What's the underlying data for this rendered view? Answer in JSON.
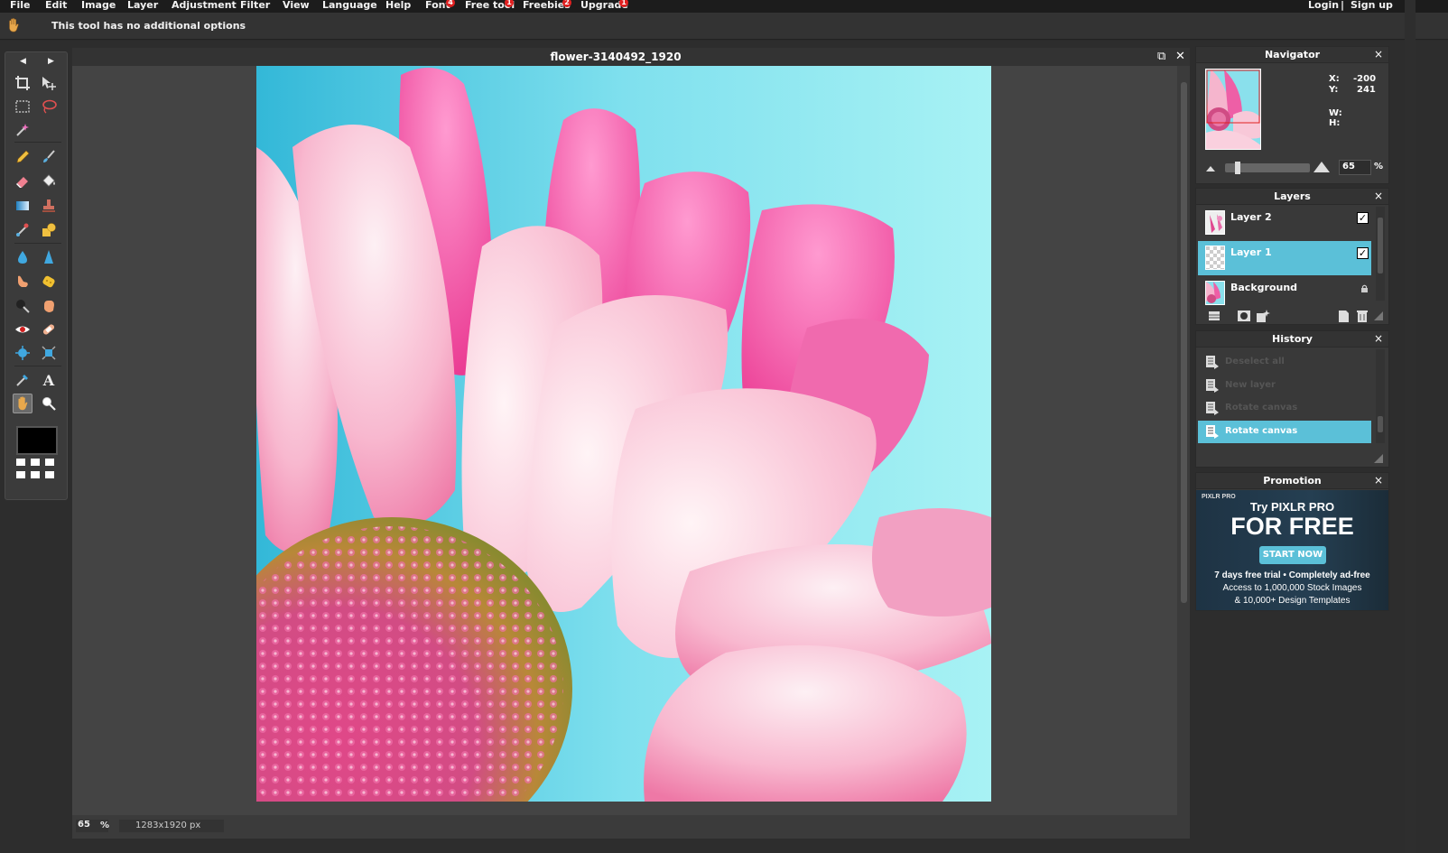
{
  "menubar": {
    "items": [
      {
        "label": "File"
      },
      {
        "label": "Edit"
      },
      {
        "label": "Image"
      },
      {
        "label": "Layer"
      },
      {
        "label": "Adjustment"
      },
      {
        "label": "Filter"
      },
      {
        "label": "View"
      },
      {
        "label": "Language"
      },
      {
        "label": "Help"
      },
      {
        "label": "Font",
        "badge": "4"
      },
      {
        "label": "Free tool",
        "badge": "1"
      },
      {
        "label": "Freebies",
        "badge": "2"
      },
      {
        "label": "Upgrade",
        "badge": "1"
      }
    ],
    "login": "Login",
    "separator": "|",
    "signup": "Sign up"
  },
  "optionsbar": {
    "tool_icon": "hand-icon",
    "text": "This tool has no additional options"
  },
  "document": {
    "title": "flower-3140492_1920",
    "zoom": "65",
    "zoom_unit": "%",
    "dimensions": "1283x1920 px"
  },
  "navigator": {
    "title": "Navigator",
    "close": "×",
    "x_label": "X:",
    "x_value": "-200",
    "y_label": "Y:",
    "y_value": "241",
    "w_label": "W:",
    "h_label": "H:",
    "zoom": "65",
    "zoom_unit": "%"
  },
  "layers": {
    "title": "Layers",
    "close": "×",
    "items": [
      {
        "name": "Layer 2",
        "visible": true,
        "selected": false
      },
      {
        "name": "Layer 1",
        "visible": true,
        "selected": true
      },
      {
        "name": "Background",
        "locked": true,
        "selected": false
      }
    ]
  },
  "history": {
    "title": "History",
    "close": "×",
    "items": [
      {
        "label": "Deselect all"
      },
      {
        "label": "New layer"
      },
      {
        "label": "Rotate canvas"
      },
      {
        "label": "Rotate canvas",
        "selected": true
      }
    ]
  },
  "promotion": {
    "title": "Promotion",
    "close": "×",
    "brand": "PIXLR PRO",
    "line1": "Try PIXLR PRO",
    "line2": "FOR FREE",
    "button": "START NOW",
    "line3": "7 days free trial • Completely ad-free",
    "line4": "Access to 1,000,000 Stock Images",
    "line5": "& 10,000+ Design Templates"
  },
  "colors": {
    "accent": "#5bc0d8",
    "badge": "#e02020",
    "foreground_color": "#000000"
  }
}
